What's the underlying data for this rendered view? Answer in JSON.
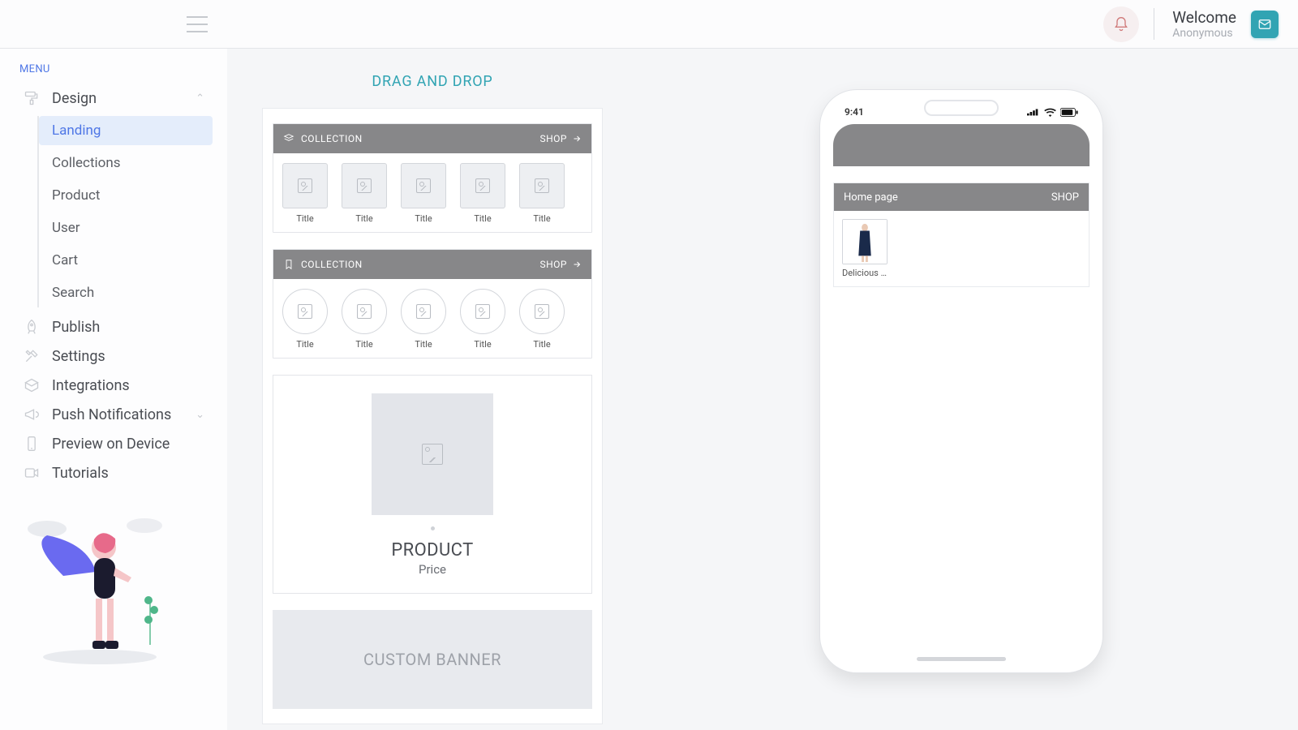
{
  "topbar": {
    "welcome_label": "Welcome",
    "user_label": "Anonymous"
  },
  "sidebar": {
    "menu_label": "MENU",
    "items": {
      "design": "Design",
      "publish": "Publish",
      "settings": "Settings",
      "integrations": "Integrations",
      "push": "Push Notifications",
      "preview": "Preview on Device",
      "tutorials": "Tutorials"
    },
    "design_sub": {
      "landing": "Landing",
      "collections": "Collections",
      "product": "Product",
      "user": "User",
      "cart": "Cart",
      "search": "Search"
    }
  },
  "builder": {
    "title": "DRAG AND DROP",
    "collection_label": "COLLECTION",
    "shop_label": "SHOP",
    "thumb_title": "Title",
    "product_label": "PRODUCT",
    "product_price": "Price",
    "custom_banner": "CUSTOM BANNER"
  },
  "phone": {
    "status_time": "9:41",
    "section_title": "Home page",
    "section_action": "SHOP",
    "product_title": "Delicious Ca…"
  }
}
